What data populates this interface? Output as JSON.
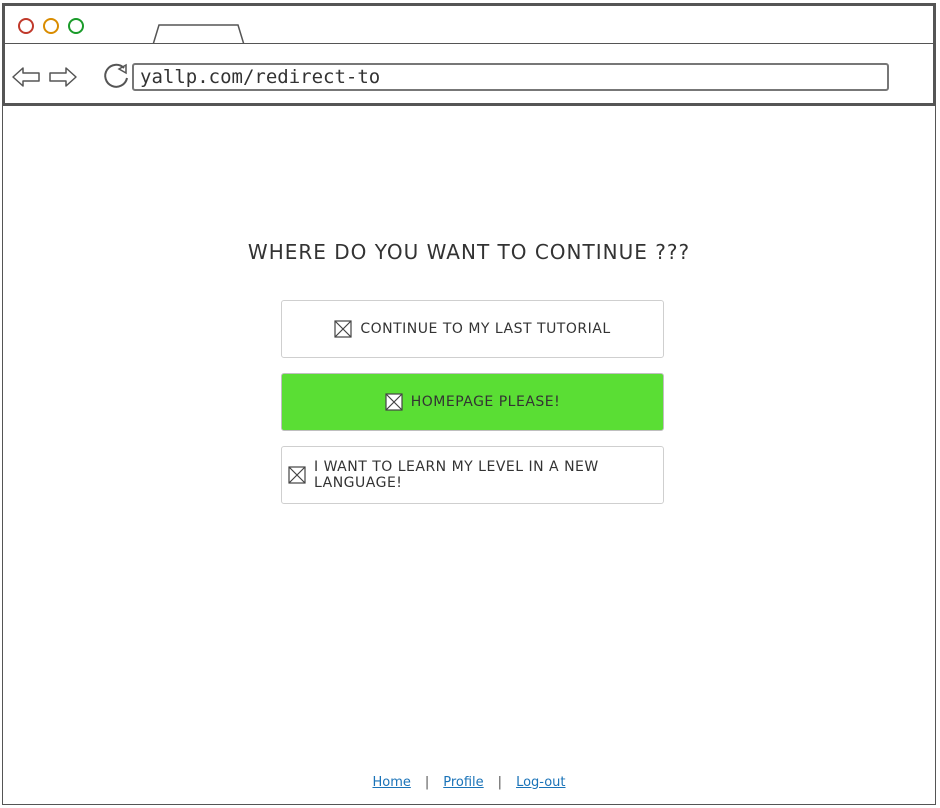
{
  "browser": {
    "url": "yallp.com/redirect-to",
    "window_controls": [
      {
        "name": "close-dot",
        "color": "#c0392b"
      },
      {
        "name": "minimize-dot",
        "color": "#d98c00"
      },
      {
        "name": "maximize-dot",
        "color": "#1a9b2a"
      }
    ],
    "nav_icons": [
      "back-arrow-icon",
      "forward-arrow-icon",
      "reload-icon"
    ]
  },
  "page": {
    "heading": "WHERE DO YOU WANT TO CONTINUE ???",
    "choices": [
      {
        "label": "CONTINUE TO MY LAST TUTORIAL",
        "icon": "image-placeholder-icon",
        "highlighted": false
      },
      {
        "label": "HOMEPAGE PLEASE!",
        "icon": "image-placeholder-icon",
        "highlighted": true,
        "color": "#5ade34"
      },
      {
        "label": "I WANT TO LEARN MY LEVEL IN A NEW LANGUAGE!",
        "icon": "image-placeholder-icon",
        "highlighted": false
      }
    ]
  },
  "footer": {
    "links": [
      "Home",
      "Profile",
      "Log-out"
    ],
    "separator": "|",
    "link_color": "#1a73b8"
  }
}
